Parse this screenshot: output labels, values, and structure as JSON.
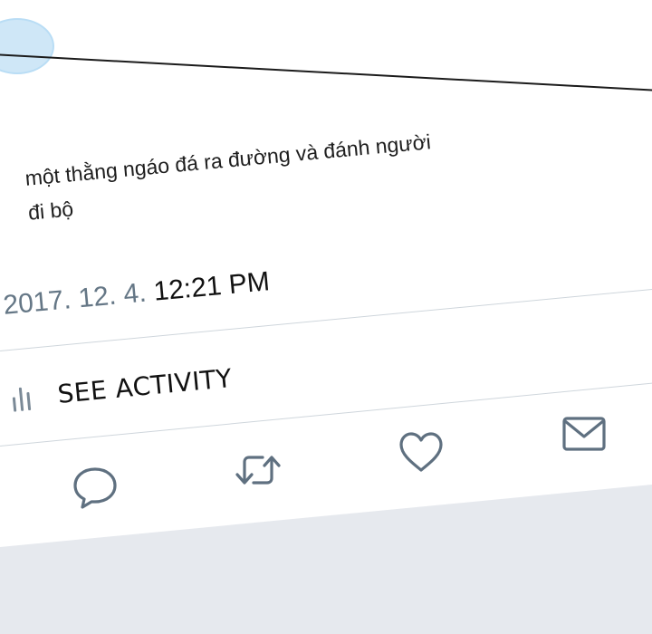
{
  "tweet": {
    "text": "một thằng ngáo đá ra đường và đánh người\nđi bộ",
    "date": "2017. 12. 4.",
    "time": "12:21 PM"
  },
  "activity": {
    "label": "SEE ACTIVITY",
    "icon": "bar-chart-icon"
  },
  "actions": [
    {
      "name": "reply",
      "icon": "speech-bubble-icon"
    },
    {
      "name": "retweet",
      "icon": "retweet-arrows-icon"
    },
    {
      "name": "like",
      "icon": "heart-icon"
    },
    {
      "name": "direct-message",
      "icon": "envelope-icon"
    }
  ],
  "colors": {
    "text": "#1e1e1e",
    "muted": "#657786",
    "divider": "#cfd6dc",
    "icon": "#5f7080",
    "footer_bg": "#e6e9ee",
    "avatar": "#cfe7f7"
  }
}
